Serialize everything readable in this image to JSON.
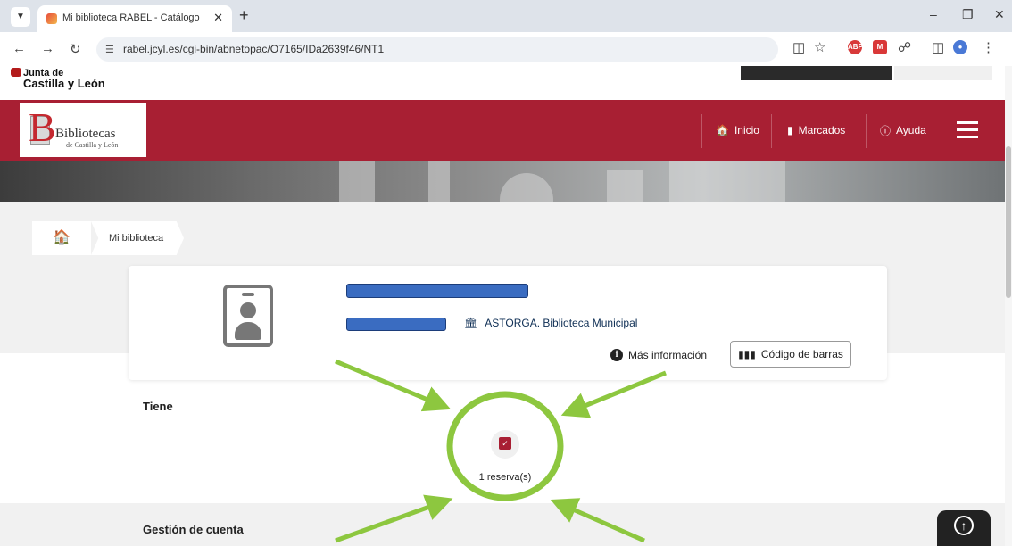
{
  "browser": {
    "tab_title": "Mi biblioteca RABEL - Catálogo",
    "url": "rabel.jcyl.es/cgi-bin/abnetopac/O7165/IDa2639f46/NT1",
    "extensions": [
      {
        "label": "ABP",
        "color": "#d83a3a"
      },
      {
        "label": "M",
        "color": "#d93838"
      }
    ]
  },
  "gov": {
    "line1": "Junta de",
    "line2": "Castilla y León"
  },
  "header": {
    "logo_title": "Bibliotecas",
    "logo_subtitle": "de Castilla y León",
    "menu": [
      {
        "label": "Inicio"
      },
      {
        "label": "Marcados"
      },
      {
        "label": "Ayuda"
      }
    ]
  },
  "breadcrumb": {
    "current": "Mi biblioteca"
  },
  "profile": {
    "library": "ASTORGA. Biblioteca Municipal",
    "more_info": "Más información",
    "barcode_button": "Código de barras"
  },
  "summary": {
    "heading": "Tiene",
    "reservations_label": "1 reserva(s)",
    "next_heading": "Gestión de cuenta"
  },
  "colors": {
    "brand_red": "#a81f33",
    "annotation_green": "#8dc73f",
    "redaction_blue": "#3a6cc1"
  }
}
